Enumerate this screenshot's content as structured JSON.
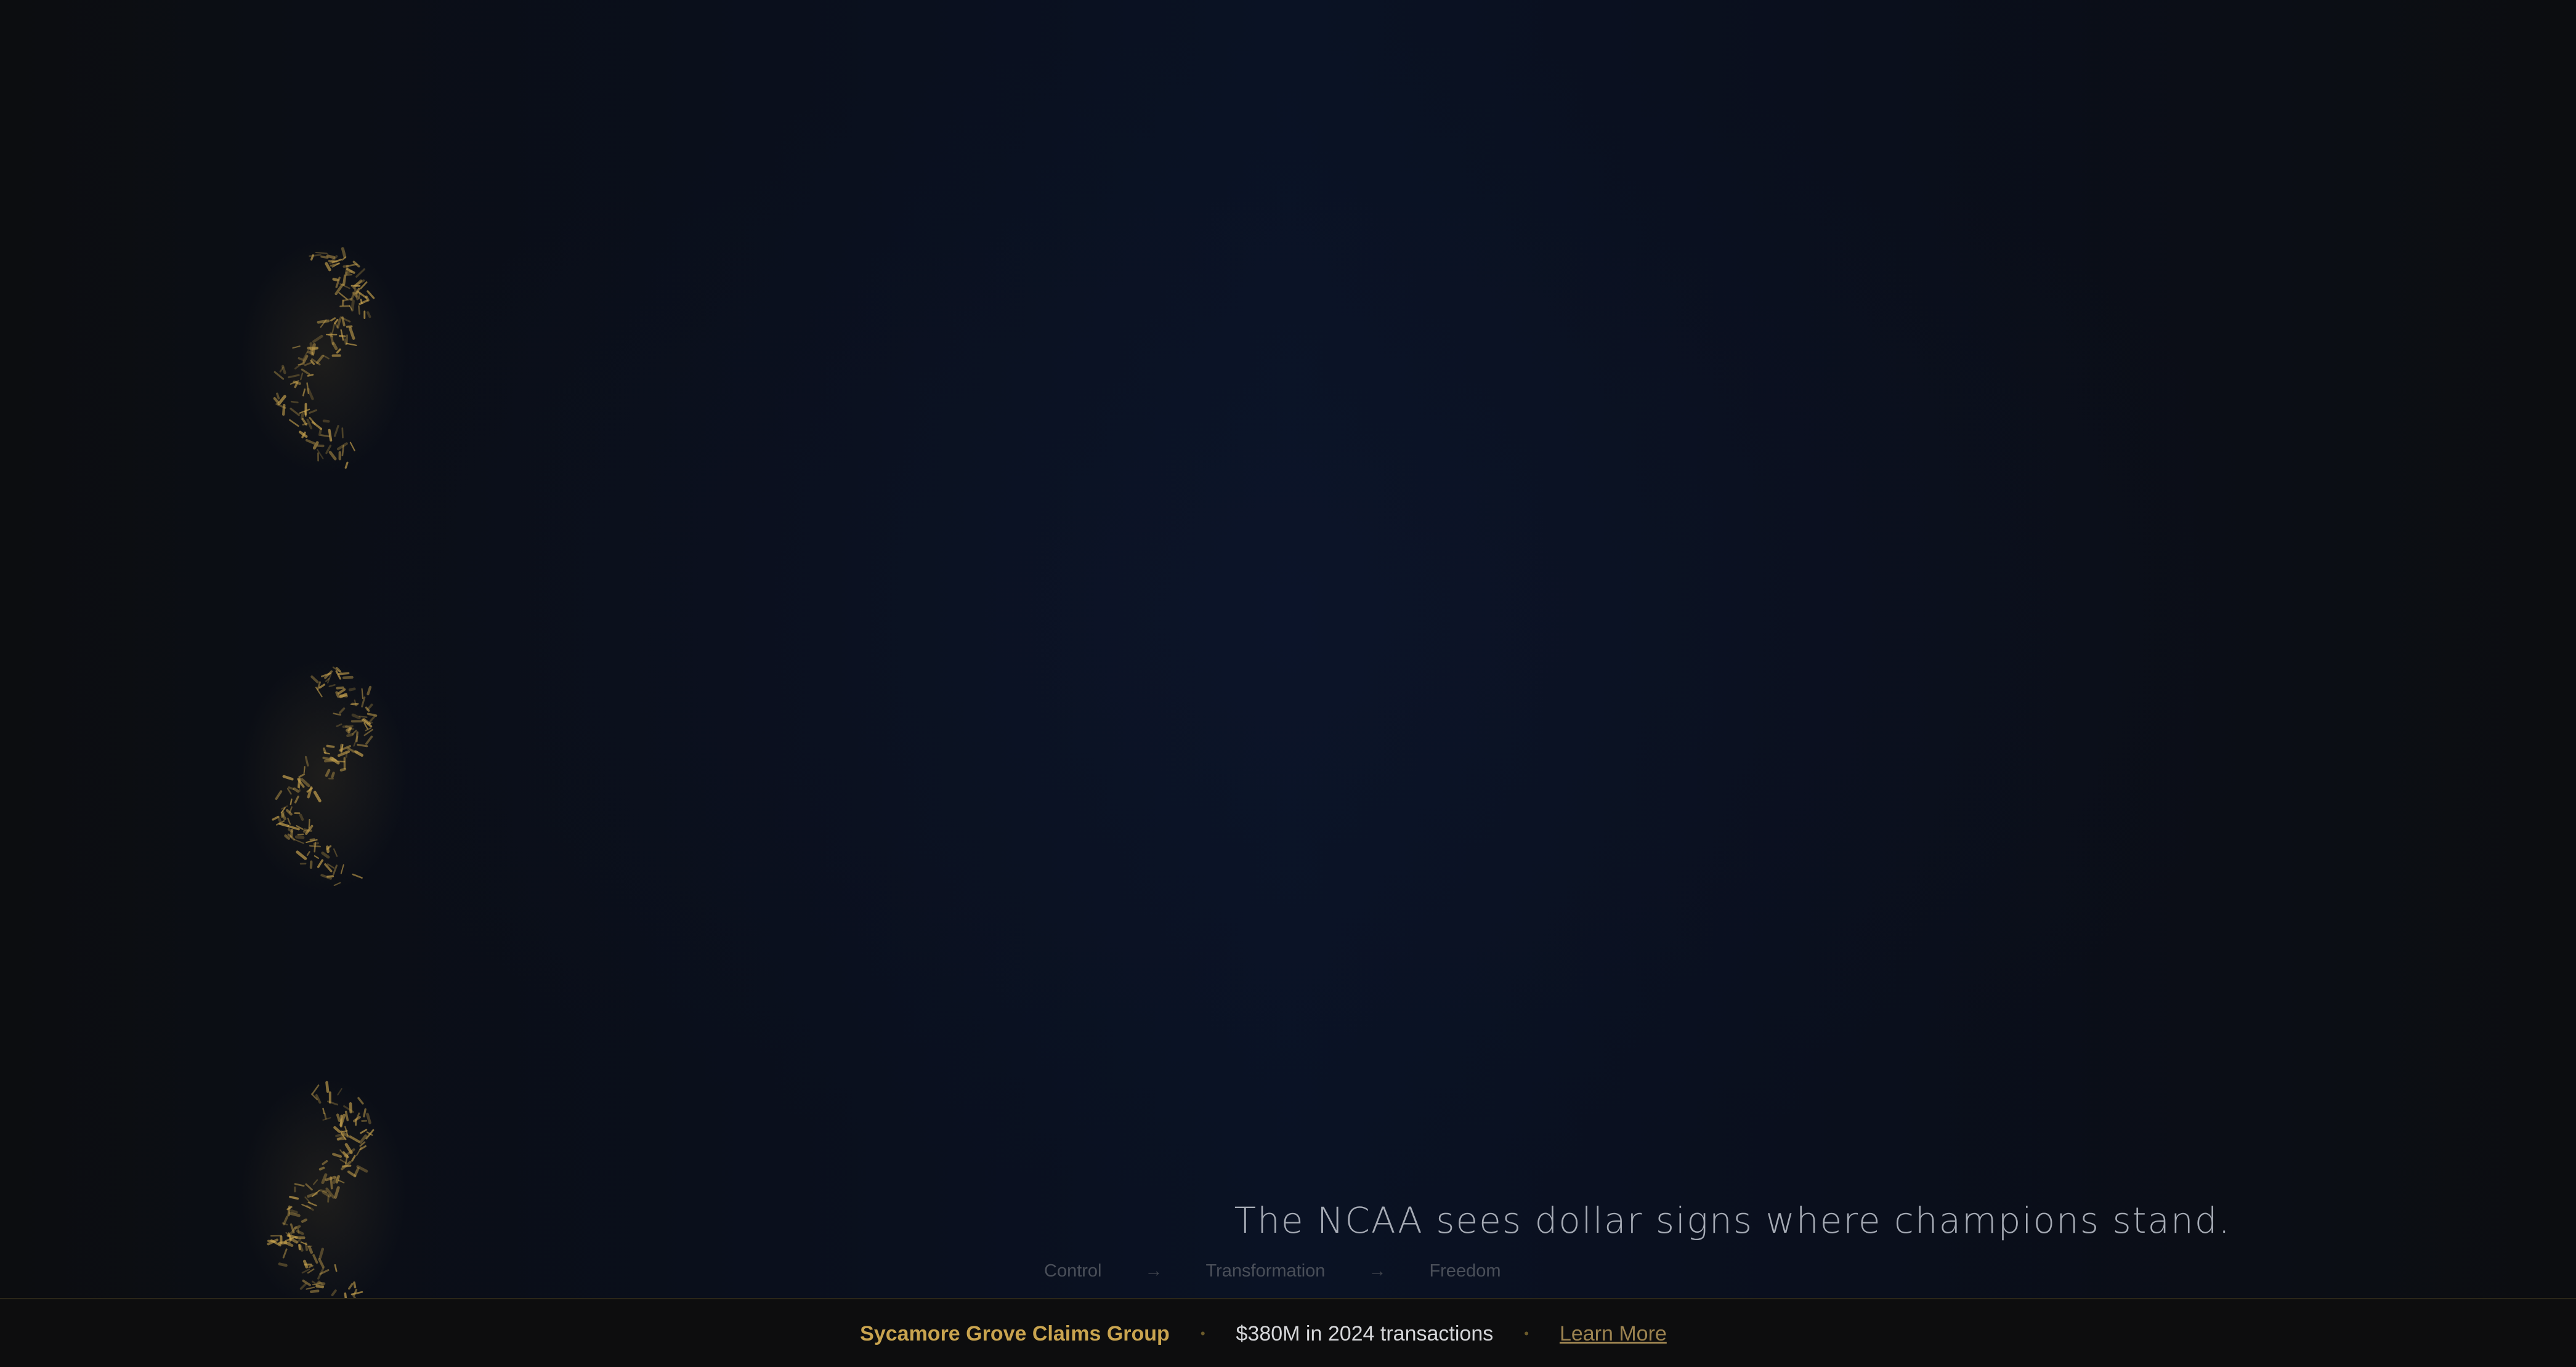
{
  "hero": {
    "tagline": "The NCAA sees dollar signs where champions stand.",
    "progression": {
      "step1": "Control",
      "step2": "Transformation",
      "step3": "Freedom",
      "separator": "→"
    }
  },
  "footer": {
    "brand": "Sycamore Grove Claims Group",
    "stat": "$380M in 2024 transactions",
    "link": "Learn More",
    "separator": "•"
  },
  "decorations": {
    "ornament_icon": "gold-dollar-swirl-icon",
    "accent_color": "#c9a44f",
    "background_color": "#0a1224"
  }
}
